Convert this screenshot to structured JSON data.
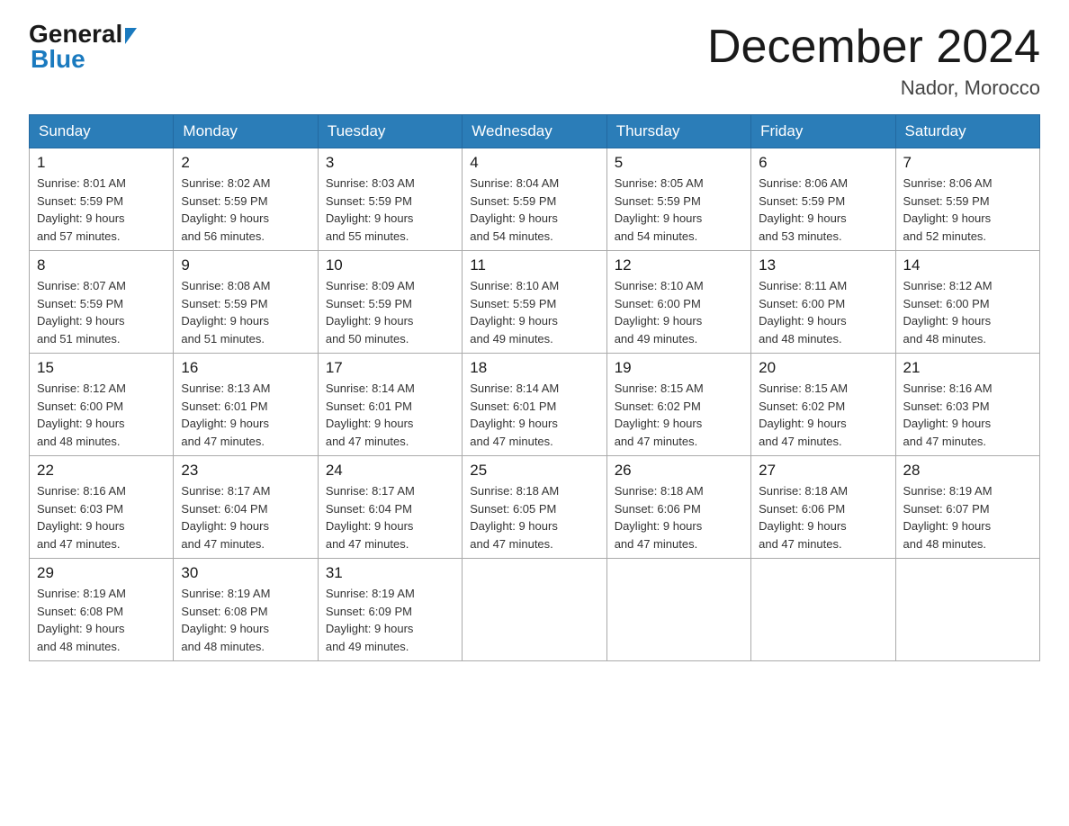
{
  "logo": {
    "general": "General",
    "blue": "Blue"
  },
  "title": "December 2024",
  "location": "Nador, Morocco",
  "days_of_week": [
    "Sunday",
    "Monday",
    "Tuesday",
    "Wednesday",
    "Thursday",
    "Friday",
    "Saturday"
  ],
  "weeks": [
    [
      {
        "day": "1",
        "sunrise": "8:01 AM",
        "sunset": "5:59 PM",
        "daylight": "9 hours and 57 minutes."
      },
      {
        "day": "2",
        "sunrise": "8:02 AM",
        "sunset": "5:59 PM",
        "daylight": "9 hours and 56 minutes."
      },
      {
        "day": "3",
        "sunrise": "8:03 AM",
        "sunset": "5:59 PM",
        "daylight": "9 hours and 55 minutes."
      },
      {
        "day": "4",
        "sunrise": "8:04 AM",
        "sunset": "5:59 PM",
        "daylight": "9 hours and 54 minutes."
      },
      {
        "day": "5",
        "sunrise": "8:05 AM",
        "sunset": "5:59 PM",
        "daylight": "9 hours and 54 minutes."
      },
      {
        "day": "6",
        "sunrise": "8:06 AM",
        "sunset": "5:59 PM",
        "daylight": "9 hours and 53 minutes."
      },
      {
        "day": "7",
        "sunrise": "8:06 AM",
        "sunset": "5:59 PM",
        "daylight": "9 hours and 52 minutes."
      }
    ],
    [
      {
        "day": "8",
        "sunrise": "8:07 AM",
        "sunset": "5:59 PM",
        "daylight": "9 hours and 51 minutes."
      },
      {
        "day": "9",
        "sunrise": "8:08 AM",
        "sunset": "5:59 PM",
        "daylight": "9 hours and 51 minutes."
      },
      {
        "day": "10",
        "sunrise": "8:09 AM",
        "sunset": "5:59 PM",
        "daylight": "9 hours and 50 minutes."
      },
      {
        "day": "11",
        "sunrise": "8:10 AM",
        "sunset": "5:59 PM",
        "daylight": "9 hours and 49 minutes."
      },
      {
        "day": "12",
        "sunrise": "8:10 AM",
        "sunset": "6:00 PM",
        "daylight": "9 hours and 49 minutes."
      },
      {
        "day": "13",
        "sunrise": "8:11 AM",
        "sunset": "6:00 PM",
        "daylight": "9 hours and 48 minutes."
      },
      {
        "day": "14",
        "sunrise": "8:12 AM",
        "sunset": "6:00 PM",
        "daylight": "9 hours and 48 minutes."
      }
    ],
    [
      {
        "day": "15",
        "sunrise": "8:12 AM",
        "sunset": "6:00 PM",
        "daylight": "9 hours and 48 minutes."
      },
      {
        "day": "16",
        "sunrise": "8:13 AM",
        "sunset": "6:01 PM",
        "daylight": "9 hours and 47 minutes."
      },
      {
        "day": "17",
        "sunrise": "8:14 AM",
        "sunset": "6:01 PM",
        "daylight": "9 hours and 47 minutes."
      },
      {
        "day": "18",
        "sunrise": "8:14 AM",
        "sunset": "6:01 PM",
        "daylight": "9 hours and 47 minutes."
      },
      {
        "day": "19",
        "sunrise": "8:15 AM",
        "sunset": "6:02 PM",
        "daylight": "9 hours and 47 minutes."
      },
      {
        "day": "20",
        "sunrise": "8:15 AM",
        "sunset": "6:02 PM",
        "daylight": "9 hours and 47 minutes."
      },
      {
        "day": "21",
        "sunrise": "8:16 AM",
        "sunset": "6:03 PM",
        "daylight": "9 hours and 47 minutes."
      }
    ],
    [
      {
        "day": "22",
        "sunrise": "8:16 AM",
        "sunset": "6:03 PM",
        "daylight": "9 hours and 47 minutes."
      },
      {
        "day": "23",
        "sunrise": "8:17 AM",
        "sunset": "6:04 PM",
        "daylight": "9 hours and 47 minutes."
      },
      {
        "day": "24",
        "sunrise": "8:17 AM",
        "sunset": "6:04 PM",
        "daylight": "9 hours and 47 minutes."
      },
      {
        "day": "25",
        "sunrise": "8:18 AM",
        "sunset": "6:05 PM",
        "daylight": "9 hours and 47 minutes."
      },
      {
        "day": "26",
        "sunrise": "8:18 AM",
        "sunset": "6:06 PM",
        "daylight": "9 hours and 47 minutes."
      },
      {
        "day": "27",
        "sunrise": "8:18 AM",
        "sunset": "6:06 PM",
        "daylight": "9 hours and 47 minutes."
      },
      {
        "day": "28",
        "sunrise": "8:19 AM",
        "sunset": "6:07 PM",
        "daylight": "9 hours and 48 minutes."
      }
    ],
    [
      {
        "day": "29",
        "sunrise": "8:19 AM",
        "sunset": "6:08 PM",
        "daylight": "9 hours and 48 minutes."
      },
      {
        "day": "30",
        "sunrise": "8:19 AM",
        "sunset": "6:08 PM",
        "daylight": "9 hours and 48 minutes."
      },
      {
        "day": "31",
        "sunrise": "8:19 AM",
        "sunset": "6:09 PM",
        "daylight": "9 hours and 49 minutes."
      },
      null,
      null,
      null,
      null
    ]
  ],
  "sunrise_label": "Sunrise:",
  "sunset_label": "Sunset:",
  "daylight_label": "Daylight:"
}
